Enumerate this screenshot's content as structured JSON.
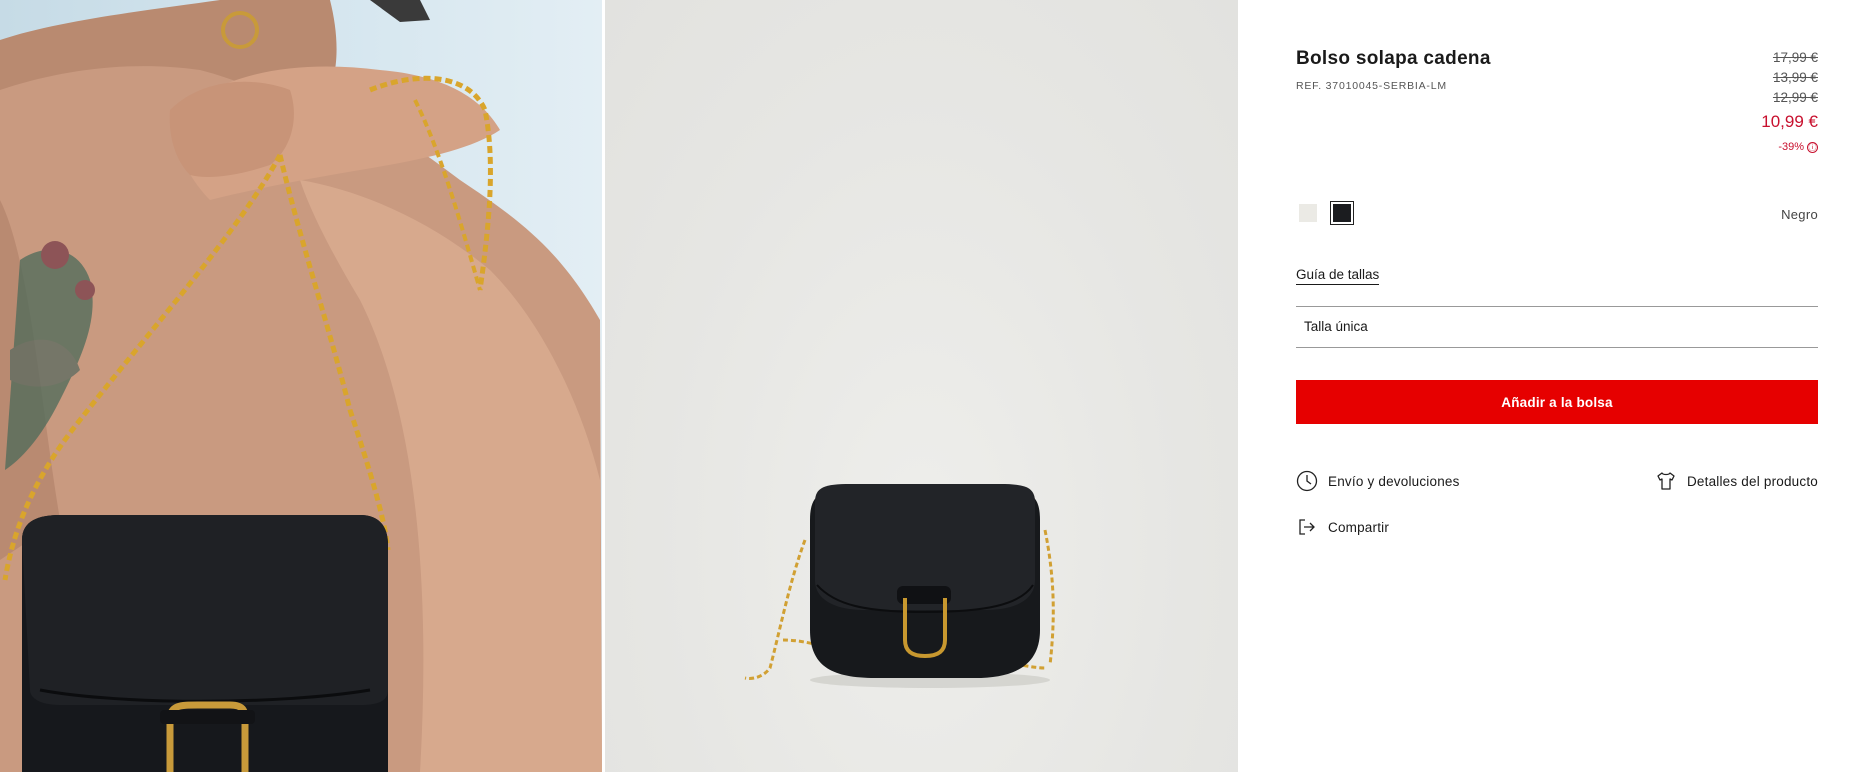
{
  "gallery": {
    "images": [
      {
        "name": "model-wearing-bag-photo"
      },
      {
        "name": "bag-product-photo"
      }
    ]
  },
  "product": {
    "title": "Bolso solapa cadena",
    "ref": "REF. 37010045-SERBIA-LM",
    "prices_old": [
      "17,99 €",
      "13,99 €",
      "12,99 €"
    ],
    "price_current": "10,99 €",
    "discount": "-39%",
    "discount_info_icon": "ⓘ"
  },
  "colors": {
    "swatches": [
      {
        "name": "off-white",
        "hex": "#ebeae5",
        "selected": false
      },
      {
        "name": "black",
        "hex": "#1b1c1f",
        "selected": true
      }
    ],
    "selected_label": "Negro"
  },
  "size": {
    "guide_label": "Guía de tallas",
    "selected": "Talla única"
  },
  "actions": {
    "add_to_bag": "Añadir a la bolsa",
    "shipping": "Envío y devoluciones",
    "details": "Detalles del producto",
    "share": "Compartir"
  },
  "icons": {
    "shipping": "clock-icon",
    "details": "tshirt-icon",
    "share": "share-arrow-icon"
  },
  "theme": {
    "accent": "#e60000",
    "sale": "#c8102e",
    "text": "#1a1a1a"
  }
}
